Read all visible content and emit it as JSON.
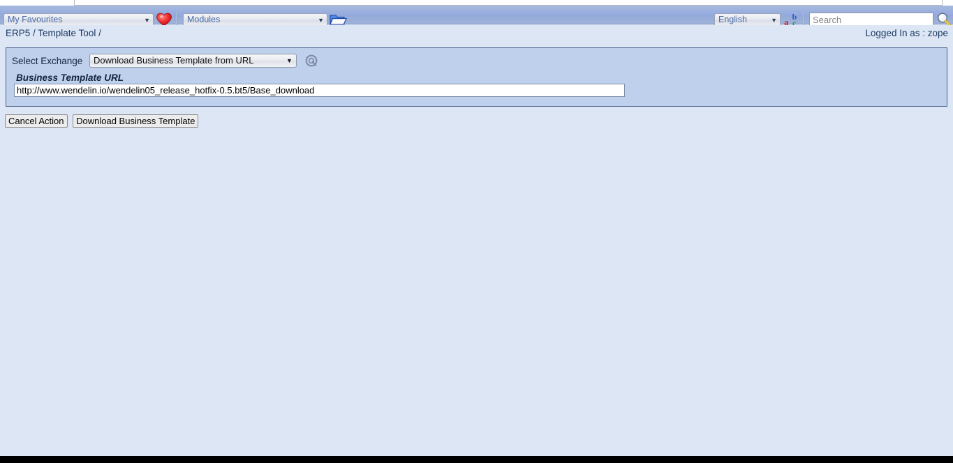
{
  "toolbar": {
    "favourites_select": {
      "value": "My Favourites",
      "caret": "▼"
    },
    "favourites_icon": "heart-icon",
    "modules_select": {
      "value": "Modules",
      "caret": "▼"
    },
    "modules_icon": "folder-icon",
    "language_select": {
      "value": "English",
      "caret": "▼"
    },
    "language_icon": "abc-translate-icon",
    "search": {
      "value": "",
      "placeholder": "Search"
    },
    "search_icon": "magnifier-icon"
  },
  "header": {
    "breadcrumb": "ERP5 / Template Tool /",
    "logged_in": "Logged In as : zope"
  },
  "form": {
    "exchange_label": "Select Exchange",
    "exchange_select": {
      "value": "Download Business Template from URL",
      "caret": "▼"
    },
    "exchange_refresh_icon": "refresh-circle-icon",
    "url_label": "Business Template URL",
    "url_input": {
      "value": "http://www.wendelin.io/wendelin05_release_hotfix-0.5.bt5/Base_download",
      "placeholder": ""
    }
  },
  "actions": {
    "cancel_label": "Cancel Action",
    "download_label": "Download Business Template"
  },
  "colors": {
    "toolbar_blue": "#97ace0",
    "page_background": "#dde6f5",
    "panel_background": "#bfd0ec",
    "panel_border": "#4a5f8a",
    "breadcrumb_text": "#1c3a62",
    "heart_red": "#e8272a",
    "folder_blue": "#2b63d9"
  }
}
